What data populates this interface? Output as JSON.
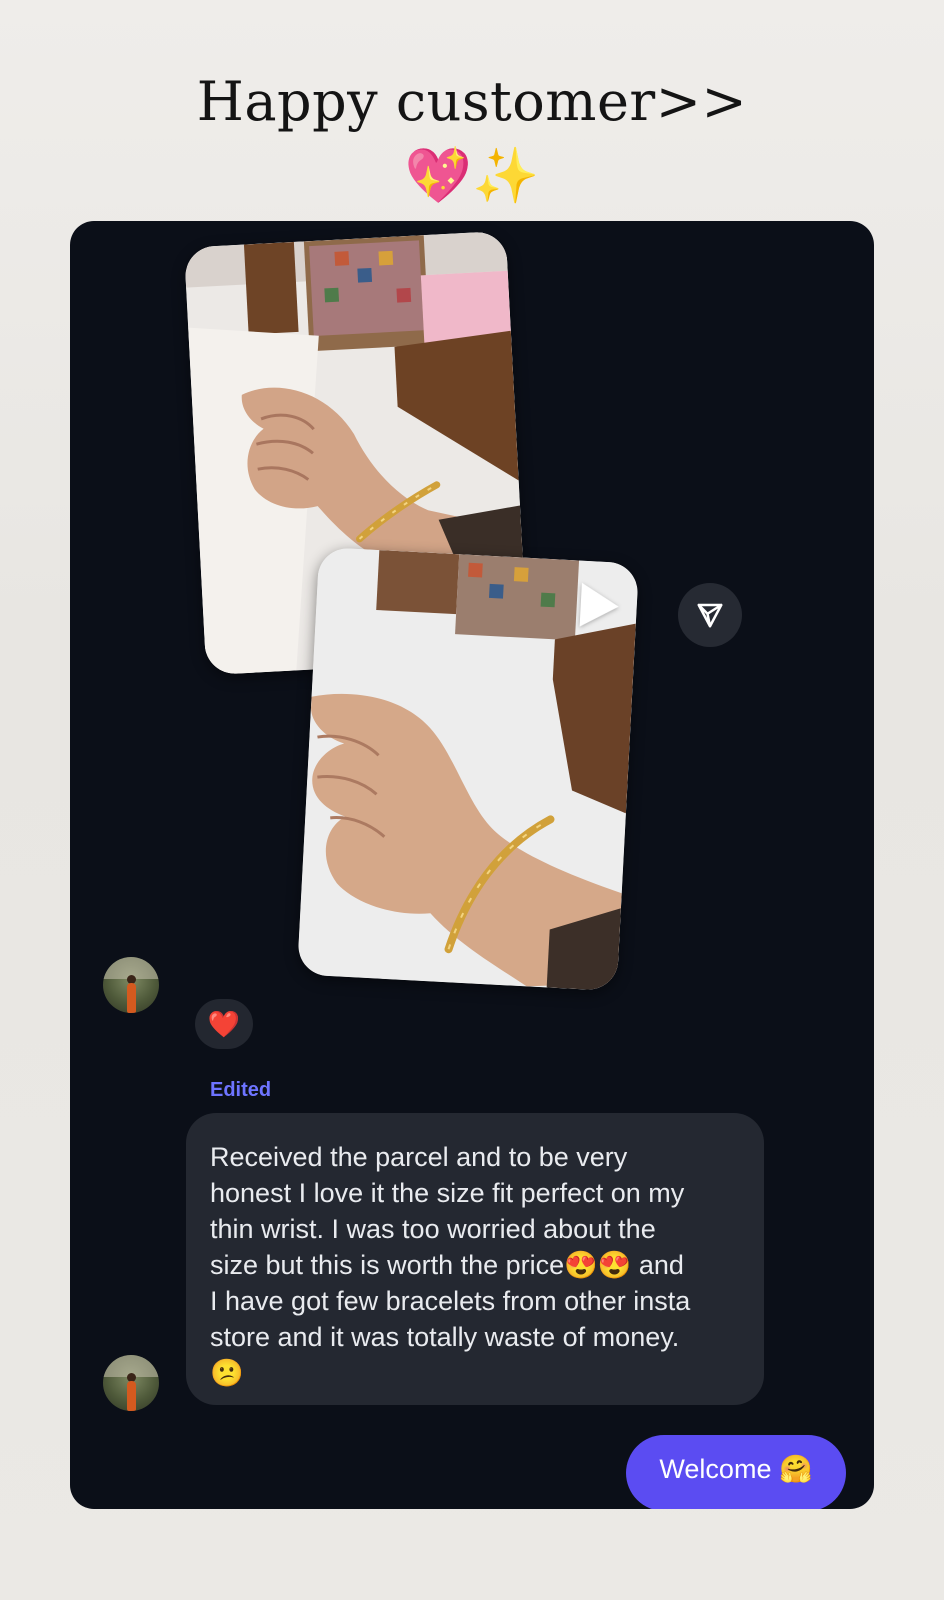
{
  "header": {
    "title": "Happy customer>>",
    "emoji": "💖✨"
  },
  "conversation": {
    "reaction": "❤️",
    "edited_label": "Edited",
    "received_message": "Received the parcel and to be very\nhonest I love it the size fit perfect on my\nthin wrist. I was too worried about the\nsize but this is worth the price😍😍 and\nI have got few bracelets from other insta\nstore and it was totally waste of money.\n😕",
    "sent_message": "Welcome 🤗"
  },
  "icons": {
    "share": "paper-plane-icon",
    "play": "play-icon",
    "avatar": "avatar"
  },
  "colors": {
    "card_background": "#0b0f18",
    "bubble_received": "#242831",
    "bubble_sent": "#5b4cf2",
    "edited_label": "#6e74ff"
  }
}
